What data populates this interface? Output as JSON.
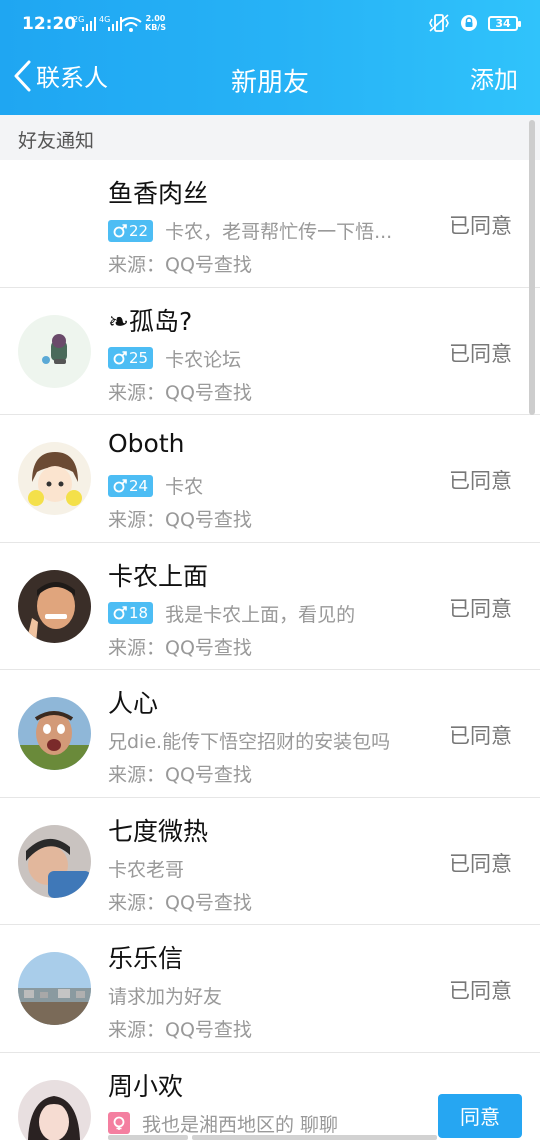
{
  "status_bar": {
    "time": "12:20",
    "signal_1_label": "2G",
    "signal_2_label": "4G",
    "net_speed": "2.00",
    "net_unit": "KB/S",
    "battery": "34"
  },
  "nav": {
    "back_label": "联系人",
    "title": "新朋友",
    "add_label": "添加"
  },
  "section_title": "好友通知",
  "requests": [
    {
      "name": "鱼香肉丝",
      "badge": "22",
      "message": "卡农，老哥帮忙传一下悟...",
      "source": "来源：QQ号查找",
      "status": "已同意"
    },
    {
      "name": "❧孤岛?",
      "badge": "25",
      "message": "卡农论坛",
      "source": "来源：QQ号查找",
      "status": "已同意"
    },
    {
      "name": "Oboth",
      "badge": "24",
      "message": "卡农",
      "source": "来源：QQ号查找",
      "status": "已同意"
    },
    {
      "name": "卡农上面",
      "badge": "18",
      "message": "我是卡农上面，看见的",
      "source": "来源：QQ号查找",
      "status": "已同意"
    },
    {
      "name": "  人心",
      "badge": "",
      "message": "兄die.能传下悟空招财的安装包吗",
      "source": "来源：QQ号查找",
      "status": "已同意"
    },
    {
      "name": "七度微热",
      "badge": "",
      "message": "卡农老哥",
      "source": "来源：QQ号查找",
      "status": "已同意"
    },
    {
      "name": "乐乐信",
      "badge": "",
      "message": "请求加为好友",
      "source": "来源：QQ号查找",
      "status": "已同意"
    },
    {
      "name": "周小欢",
      "badge": "",
      "message": "我也是湘西地区的 聊聊",
      "source": "",
      "action": "同意"
    }
  ],
  "colors": {
    "accent": "#26a6f2",
    "male_badge": "#4dbdf4",
    "female_badge": "#f47fa0",
    "muted_text": "#999999"
  }
}
